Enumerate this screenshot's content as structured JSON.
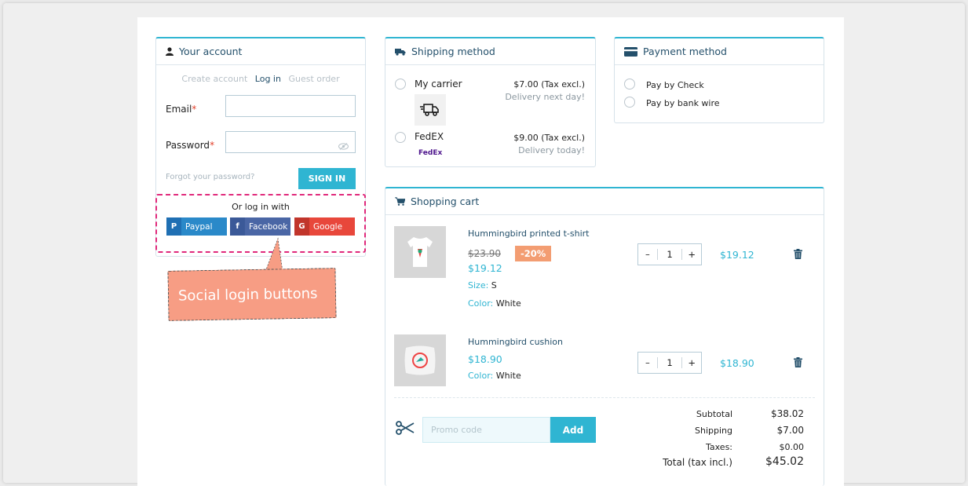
{
  "account": {
    "title": "Your account",
    "tabs": [
      "Create account",
      "Log in",
      "Guest order"
    ],
    "email_label": "Email",
    "password_label": "Password",
    "required_mark": "*",
    "forgot": "Forgot your password?",
    "signin": "SIGN IN",
    "social_title": "Or log in with",
    "social": [
      {
        "badge": "P",
        "label": "Paypal",
        "color": "#1f6fb3"
      },
      {
        "badge": "f",
        "label": "Facebook",
        "color": "#3b5998"
      },
      {
        "badge": "G",
        "label": "Google",
        "color": "#e8473b"
      }
    ],
    "callout": "Social login buttons"
  },
  "shipping": {
    "title": "Shipping method",
    "carriers": [
      {
        "name": "My carrier",
        "price": "$7.00 (Tax excl.)",
        "delay": "Delivery next day!",
        "icon": "delivery-truck-icon"
      },
      {
        "name": "FedEX",
        "price": "$9.00 (Tax excl.)",
        "delay": "Delivery today!",
        "logo_text": "FedEx"
      }
    ]
  },
  "payment": {
    "title": "Payment method",
    "options": [
      "Pay by Check",
      "Pay by bank wire"
    ]
  },
  "cart": {
    "title": "Shopping cart",
    "items": [
      {
        "name": "Hummingbird printed t-shirt",
        "old_price": "$23.90",
        "discount": "-20%",
        "price": "$19.12",
        "size_label": "Size:",
        "size": "S",
        "color_label": "Color:",
        "color": "White",
        "qty": "1",
        "total": "$19.12"
      },
      {
        "name": "Hummingbird cushion",
        "price": "$18.90",
        "color_label": "Color:",
        "color": "White",
        "qty": "1",
        "total": "$18.90"
      }
    ],
    "qty_minus": "–",
    "qty_plus": "+",
    "promo_placeholder": "Promo code",
    "promo_add": "Add",
    "totals": {
      "subtotal_label": "Subtotal",
      "subtotal": "$38.02",
      "shipping_label": "Shipping",
      "shipping": "$7.00",
      "taxes_label": "Taxes:",
      "taxes": "$0.00",
      "total_label": "Total (tax incl.)",
      "total": "$45.02"
    }
  },
  "colors": {
    "accent": "#2fb5d2",
    "highlight": "#e0297b",
    "callout": "#f79d84"
  }
}
